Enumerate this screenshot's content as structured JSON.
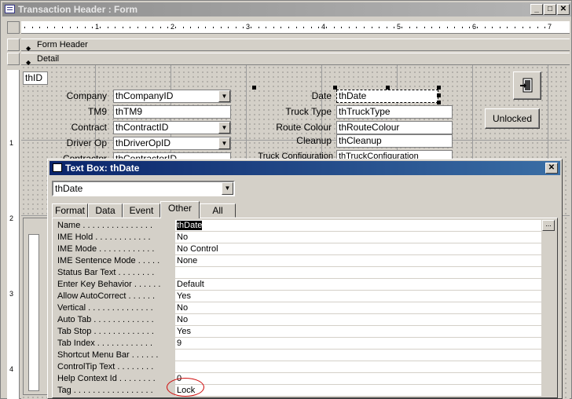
{
  "window": {
    "title": "Transaction Header : Form",
    "minimize": "_",
    "maximize": "□",
    "close": "✕"
  },
  "ruler": {
    "h_numbers": [
      "1",
      "2",
      "3",
      "4",
      "5",
      "6",
      "7"
    ],
    "v_numbers": [
      "1",
      "2",
      "3",
      "4"
    ]
  },
  "sections": {
    "form_header": "Form Header",
    "detail": "Detail"
  },
  "form": {
    "id_box": "thID",
    "left_labels": [
      "Company",
      "TM9",
      "Contract",
      "Driver Op",
      "Contractor"
    ],
    "left_fields": [
      "thCompanyID",
      "thTM9",
      "thContractID",
      "thDriverOpID",
      "thContractorID"
    ],
    "right_labels": [
      "Date",
      "Truck Type",
      "Route Colour",
      "Cleanup",
      "Truck Configuration"
    ],
    "right_fields": [
      "thDate",
      "thTruckType",
      "thRouteColour",
      "thCleanup",
      "thTruckConfiguration"
    ],
    "unlocked_button": "Unlocked",
    "exit_icon": "door-exit-icon"
  },
  "property_sheet": {
    "title": "Text Box: thDate",
    "object": "thDate",
    "tabs": [
      "Format",
      "Data",
      "Event",
      "Other",
      "All"
    ],
    "active_tab": "Other",
    "build_button": "...",
    "properties": [
      {
        "name": "Name . . . . . . . . . . . . . . .",
        "value": "thDate"
      },
      {
        "name": "IME Hold . . . . . . . . . . . .",
        "value": "No"
      },
      {
        "name": "IME Mode . . . . . . . . . . . .",
        "value": "No Control"
      },
      {
        "name": "IME Sentence Mode . . . . .",
        "value": "None"
      },
      {
        "name": "Status Bar Text . . . . . . . .",
        "value": ""
      },
      {
        "name": "Enter Key Behavior . . . . . .",
        "value": "Default"
      },
      {
        "name": "Allow AutoCorrect . . . . . .",
        "value": "Yes"
      },
      {
        "name": "Vertical . . . . . . . . . . . . . .",
        "value": "No"
      },
      {
        "name": "Auto Tab . . . . . . . . . . . . .",
        "value": "No"
      },
      {
        "name": "Tab Stop . . . . . . . . . . . . .",
        "value": "Yes"
      },
      {
        "name": "Tab Index . . . . . . . . . . . .",
        "value": "9"
      },
      {
        "name": "Shortcut Menu Bar . . . . . .",
        "value": ""
      },
      {
        "name": "ControlTip Text . . . . . . . .",
        "value": ""
      },
      {
        "name": "Help Context Id . . . . . . . .",
        "value": "0"
      },
      {
        "name": "Tag . . . . . . . . . . . . . . . . .",
        "value": "Lock"
      }
    ]
  }
}
